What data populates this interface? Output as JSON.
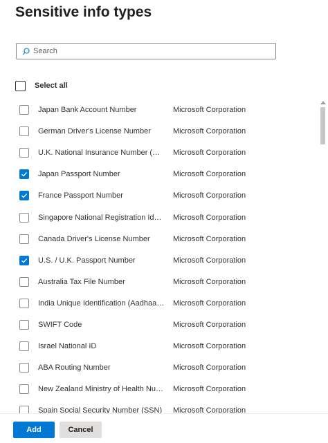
{
  "header": {
    "title": "Sensitive info types"
  },
  "search": {
    "placeholder": "Search",
    "value": ""
  },
  "select_all": {
    "label": "Select all",
    "checked": false
  },
  "items": [
    {
      "name": "Japan Bank Account Number",
      "publisher": "Microsoft Corporation",
      "checked": false
    },
    {
      "name": "German Driver's License Number",
      "publisher": "Microsoft Corporation",
      "checked": false
    },
    {
      "name": "U.K. National Insurance Number (NINO)",
      "publisher": "Microsoft Corporation",
      "checked": false
    },
    {
      "name": "Japan Passport Number",
      "publisher": "Microsoft Corporation",
      "checked": true
    },
    {
      "name": "France Passport Number",
      "publisher": "Microsoft Corporation",
      "checked": true
    },
    {
      "name": "Singapore National Registration Identity Card (NRIC) Number",
      "publisher": "Microsoft Corporation",
      "checked": false
    },
    {
      "name": "Canada Driver's License Number",
      "publisher": "Microsoft Corporation",
      "checked": false
    },
    {
      "name": "U.S. / U.K. Passport Number",
      "publisher": "Microsoft Corporation",
      "checked": true
    },
    {
      "name": "Australia Tax File Number",
      "publisher": "Microsoft Corporation",
      "checked": false
    },
    {
      "name": "India Unique Identification (Aadhaar) Number",
      "publisher": "Microsoft Corporation",
      "checked": false
    },
    {
      "name": "SWIFT Code",
      "publisher": "Microsoft Corporation",
      "checked": false
    },
    {
      "name": "Israel National ID",
      "publisher": "Microsoft Corporation",
      "checked": false
    },
    {
      "name": "ABA Routing Number",
      "publisher": "Microsoft Corporation",
      "checked": false
    },
    {
      "name": "New Zealand Ministry of Health Number",
      "publisher": "Microsoft Corporation",
      "checked": false
    },
    {
      "name": "Spain Social Security Number (SSN)",
      "publisher": "Microsoft Corporation",
      "checked": false
    }
  ],
  "footer": {
    "add_label": "Add",
    "cancel_label": "Cancel"
  },
  "colors": {
    "accent": "#0078d4",
    "cancel_bg": "#e1dfdd",
    "text": "#323130"
  },
  "icons": {
    "search": "search-icon",
    "checkmark": "checkmark-icon",
    "scroll_up": "scroll-up-arrow"
  }
}
